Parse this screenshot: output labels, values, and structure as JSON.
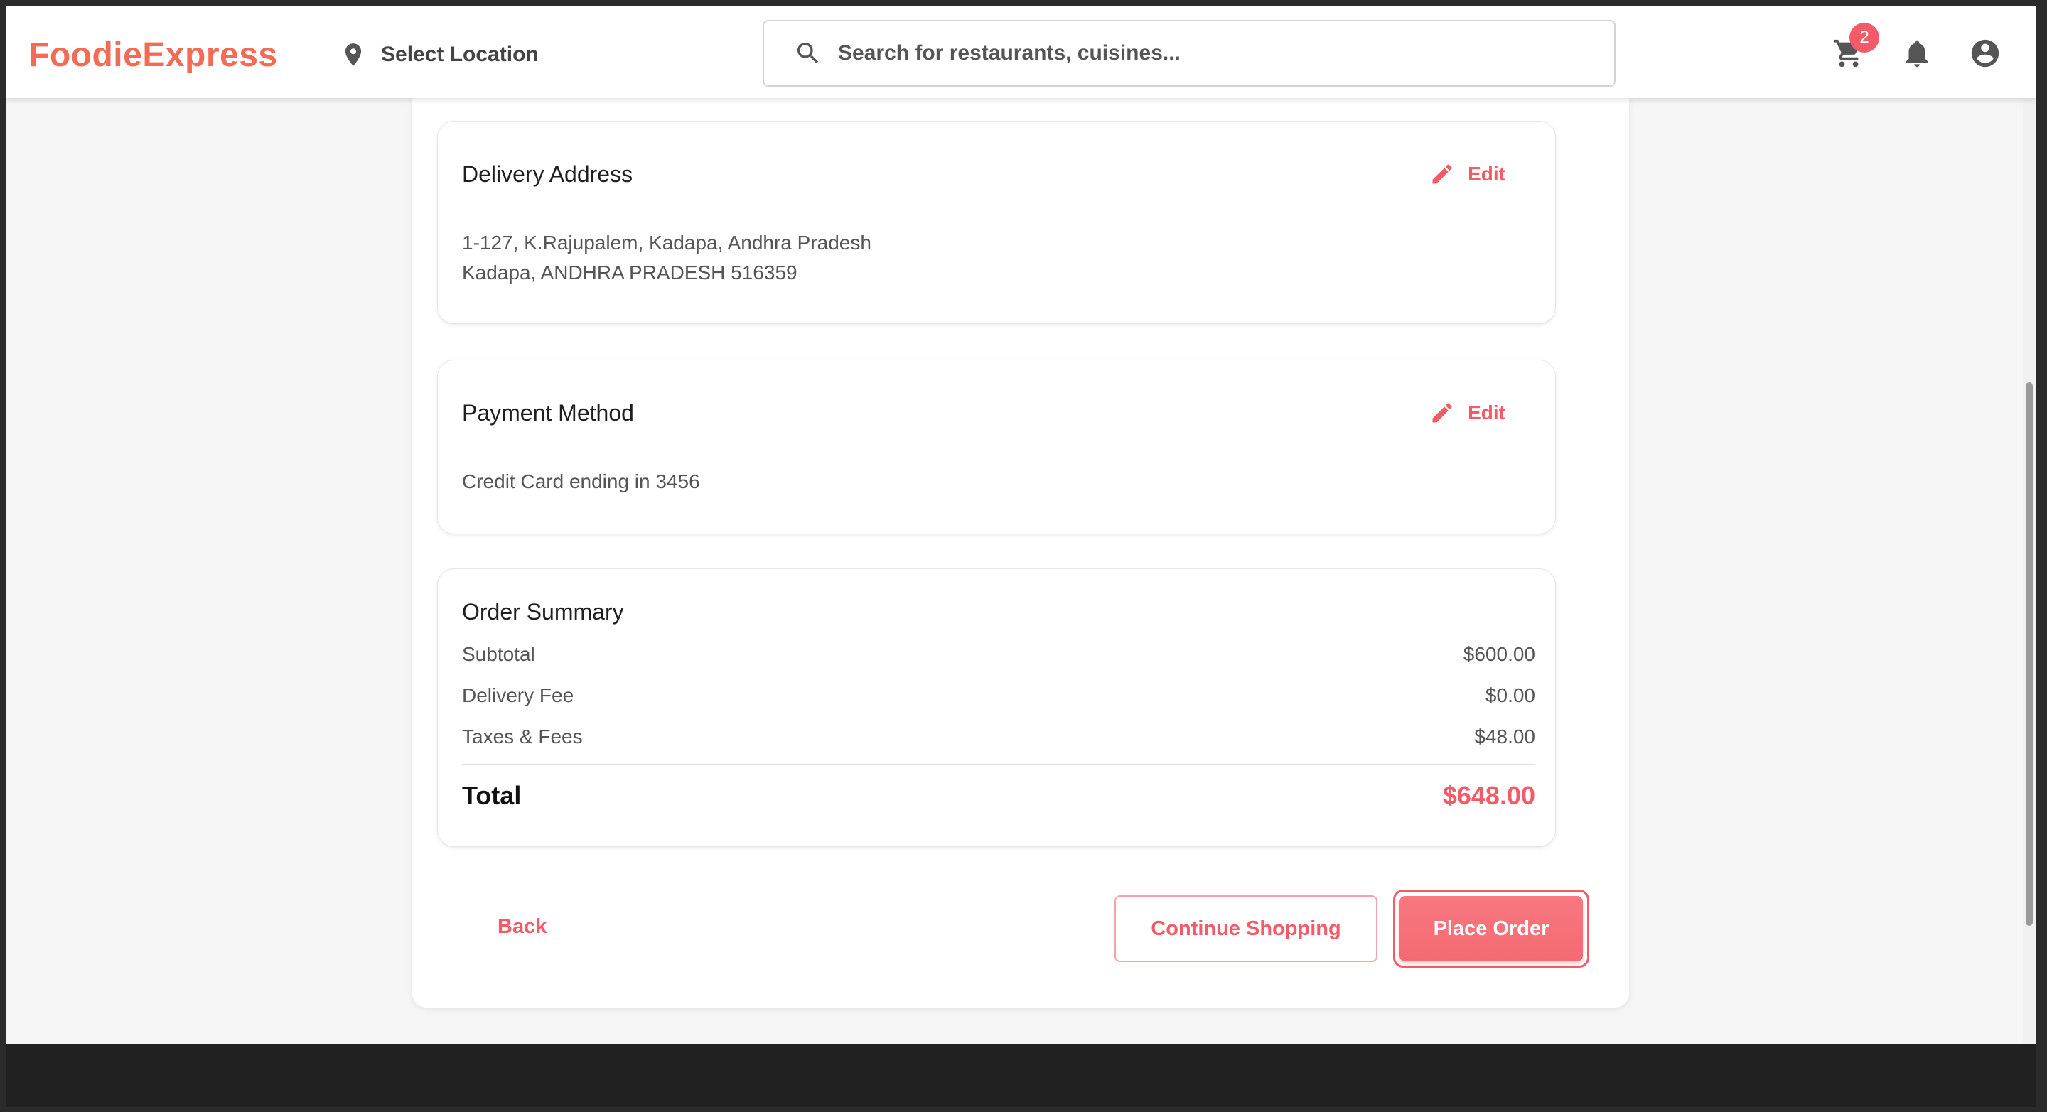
{
  "header": {
    "brand": "FoodieExpress",
    "location_label": "Select Location",
    "search_placeholder": "Search for restaurants, cuisines...",
    "cart_count": "2",
    "icons": [
      "location-pin-icon",
      "search-icon",
      "cart-icon",
      "bell-icon",
      "account-circle-icon"
    ]
  },
  "delivery": {
    "title": "Delivery Address",
    "edit_label": "Edit",
    "line1": "1-127, K.Rajupalem, Kadapa, Andhra Pradesh",
    "line2": "Kadapa, ANDHRA PRADESH 516359"
  },
  "payment": {
    "title": "Payment Method",
    "edit_label": "Edit",
    "method": "Credit Card ending in 3456"
  },
  "summary": {
    "title": "Order Summary",
    "rows": [
      {
        "label": "Subtotal",
        "value": "$600.00"
      },
      {
        "label": "Delivery Fee",
        "value": "$0.00"
      },
      {
        "label": "Taxes & Fees",
        "value": "$48.00"
      }
    ],
    "total_label": "Total",
    "total_value": "$648.00"
  },
  "actions": {
    "back": "Back",
    "continue": "Continue Shopping",
    "place": "Place Order"
  },
  "colors": {
    "brand": "#f26b55",
    "accent": "#f45b69"
  }
}
